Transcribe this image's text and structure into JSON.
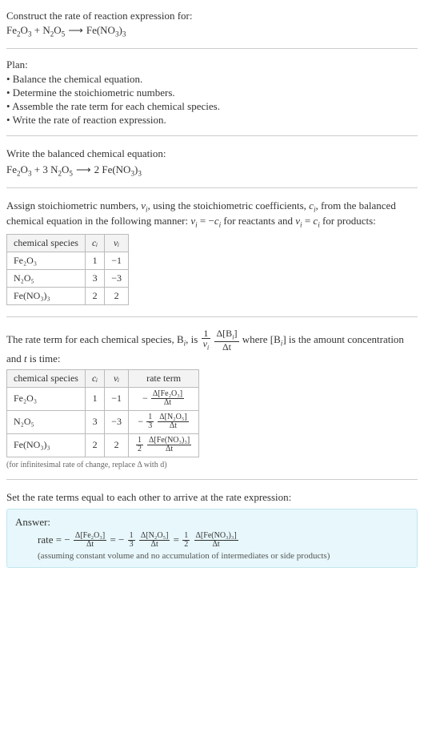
{
  "prompt": {
    "line1": "Construct the rate of reaction expression for:",
    "eq_lhs1": "Fe",
    "eq_lhs1_sub1": "2",
    "eq_lhs1_o": "O",
    "eq_lhs1_sub2": "3",
    "plus1": " + ",
    "eq_lhs2": "N",
    "eq_lhs2_sub1": "2",
    "eq_lhs2_o": "O",
    "eq_lhs2_sub2": "5",
    "arrow": "⟶",
    "eq_rhs": "Fe(NO",
    "eq_rhs_sub1": "3",
    "eq_rhs_close": ")",
    "eq_rhs_sub2": "3"
  },
  "plan": {
    "heading": "Plan:",
    "items": [
      "• Balance the chemical equation.",
      "• Determine the stoichiometric numbers.",
      "• Assemble the rate term for each chemical species.",
      "• Write the rate of reaction expression."
    ]
  },
  "balanced": {
    "heading": "Write the balanced chemical equation:",
    "c1": "",
    "s1": "Fe",
    "s1a": "2",
    "s1o": "O",
    "s1b": "3",
    "plus": " + ",
    "c2": "3 ",
    "s2": "N",
    "s2a": "2",
    "s2o": "O",
    "s2b": "5",
    "arrow": "⟶",
    "c3": "2 ",
    "s3": "Fe(NO",
    "s3a": "3",
    "s3c": ")",
    "s3b": "3"
  },
  "assign_text_1": "Assign stoichiometric numbers, ",
  "assign_nu": "ν",
  "assign_i": "i",
  "assign_text_2": ", using the stoichiometric coefficients, ",
  "assign_c": "c",
  "assign_text_3": ", from the balanced chemical equation in the following manner: ",
  "assign_rel1_a": "ν",
  "assign_rel1_b": " = −",
  "assign_rel1_c": "c",
  "assign_text_4": " for reactants and ",
  "assign_rel2_a": "ν",
  "assign_rel2_b": " = ",
  "assign_rel2_c": "c",
  "assign_text_5": " for products:",
  "table1": {
    "head": {
      "h1": "chemical species",
      "h2": "cᵢ",
      "h3": "νᵢ"
    },
    "rows": [
      {
        "sp": "Fe₂O₃",
        "c": "1",
        "nu": "−1"
      },
      {
        "sp": "N₂O₅",
        "c": "3",
        "nu": "−3"
      },
      {
        "sp": "Fe(NO₃)₃",
        "c": "2",
        "nu": "2"
      }
    ]
  },
  "rate_term_text_1": "The rate term for each chemical species, B",
  "rate_term_text_2": ", is ",
  "rate_frac_outer_num": "1",
  "rate_frac_outer_den_a": "ν",
  "rate_frac_outer_den_i": "i",
  "rate_frac_inner_num_a": "Δ[B",
  "rate_frac_inner_num_b": "]",
  "rate_frac_inner_den": "Δt",
  "rate_term_text_3": " where [B",
  "rate_term_text_4": "] is the amount concentration and ",
  "rate_t": "t",
  "rate_term_text_5": " is time:",
  "table2": {
    "head": {
      "h1": "chemical species",
      "h2": "cᵢ",
      "h3": "νᵢ",
      "h4": "rate term"
    },
    "rows": [
      {
        "sp": "Fe₂O₃",
        "c": "1",
        "nu": "−1",
        "coef": "−",
        "num": "Δ[Fe₂O₃]",
        "den": "Δt"
      },
      {
        "sp": "N₂O₅",
        "c": "3",
        "nu": "−3",
        "coef_pref": "−",
        "coef_num": "1",
        "coef_den": "3",
        "num": "Δ[N₂O₅]",
        "den": "Δt"
      },
      {
        "sp": "Fe(NO₃)₃",
        "c": "2",
        "nu": "2",
        "coef_num": "1",
        "coef_den": "2",
        "num": "Δ[Fe(NO₃)₃]",
        "den": "Δt"
      }
    ]
  },
  "footnote": "(for infinitesimal rate of change, replace Δ with d)",
  "set_equal": "Set the rate terms equal to each other to arrive at the rate expression:",
  "answer": {
    "label": "Answer:",
    "rate_word": "rate = −",
    "t1_num": "Δ[Fe₂O₃]",
    "t1_den": "Δt",
    "eq": " = ",
    "t2_pref": "−",
    "t2_cnum": "1",
    "t2_cden": "3",
    "t2_num": "Δ[N₂O₅]",
    "t2_den": "Δt",
    "t3_cnum": "1",
    "t3_cden": "2",
    "t3_num": "Δ[Fe(NO₃)₃]",
    "t3_den": "Δt",
    "assume": "(assuming constant volume and no accumulation of intermediates or side products)"
  },
  "chart_data": {
    "type": "table",
    "tables": [
      {
        "title": "Stoichiometric numbers",
        "columns": [
          "chemical species",
          "c_i",
          "nu_i"
        ],
        "rows": [
          [
            "Fe2O3",
            1,
            -1
          ],
          [
            "N2O5",
            3,
            -3
          ],
          [
            "Fe(NO3)3",
            2,
            2
          ]
        ]
      },
      {
        "title": "Rate terms",
        "columns": [
          "chemical species",
          "c_i",
          "nu_i",
          "rate term"
        ],
        "rows": [
          [
            "Fe2O3",
            1,
            -1,
            "-(Δ[Fe2O3]/Δt)"
          ],
          [
            "N2O5",
            3,
            -3,
            "-(1/3)(Δ[N2O5]/Δt)"
          ],
          [
            "Fe(NO3)3",
            2,
            2,
            "(1/2)(Δ[Fe(NO3)3]/Δt)"
          ]
        ]
      }
    ],
    "balanced_equation": "Fe2O3 + 3 N2O5 -> 2 Fe(NO3)3",
    "rate_expression": "rate = -(Δ[Fe2O3]/Δt) = -(1/3)(Δ[N2O5]/Δt) = (1/2)(Δ[Fe(NO3)3]/Δt)"
  }
}
